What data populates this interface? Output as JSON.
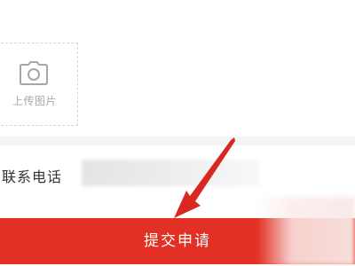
{
  "upload": {
    "icon": "camera-icon",
    "label": "上传图片"
  },
  "contact": {
    "label": "联系电话",
    "value": ""
  },
  "submit": {
    "label": "提交申请",
    "color": "#e23124"
  },
  "annotation": {
    "icon": "arrow-icon",
    "color": "#d8281f"
  }
}
